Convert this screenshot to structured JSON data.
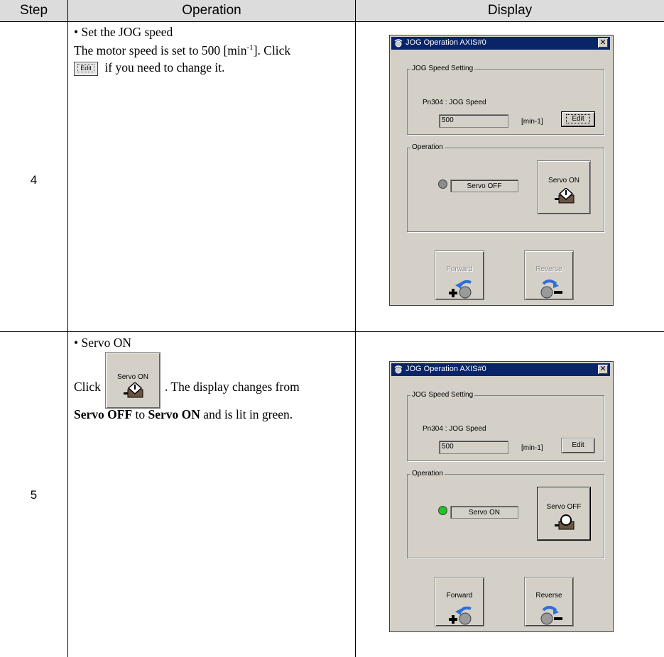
{
  "table": {
    "headers": {
      "step": "Step",
      "operation": "Operation",
      "display": "Display"
    }
  },
  "rows": [
    {
      "step": "4",
      "bullet": "•  Set the JOG speed",
      "text_1": "The motor speed is set to 500 [min",
      "superscript": "-1",
      "text_2": "]. Click",
      "inline_button": "Edit",
      "text_3": "if you need to change it."
    },
    {
      "step": "5",
      "bullet": "•  Servo ON",
      "click_word": "Click",
      "inline_button": "Servo ON",
      "text_after_button": ". The display changes from",
      "bold_1": "Servo OFF",
      "to_word": "to",
      "bold_2": "Servo ON",
      "text_end": "and is lit in green."
    }
  ],
  "dialogs": [
    {
      "title": "JOG Operation AXIS#0",
      "close_glyph": "✕",
      "speed_group": "JOG Speed Setting",
      "param_label": "Pn304 : JOG Speed",
      "speed_value": "500",
      "unit": "[min-1]",
      "edit_label": "Edit",
      "operation_group": "Operation",
      "servo_status": "Servo OFF",
      "servo_button": "Servo ON",
      "led_color": "#8c8c8c",
      "forward": "Forward",
      "reverse": "Reverse",
      "direction_enabled": false
    },
    {
      "title": "JOG Operation AXIS#0",
      "close_glyph": "✕",
      "speed_group": "JOG Speed Setting",
      "param_label": "Pn304 : JOG Speed",
      "speed_value": "500",
      "unit": "[min-1]",
      "edit_label": "Edit",
      "operation_group": "Operation",
      "servo_status": "Servo ON",
      "servo_button": "Servo OFF",
      "led_color": "#22c322",
      "forward": "Forward",
      "reverse": "Reverse",
      "direction_enabled": true
    }
  ],
  "icons": {
    "title_icon": "connection-icon",
    "servo_on_icon": "servo-motor-on-icon",
    "servo_off_icon": "servo-motor-off-icon",
    "forward_icon": "forward-rotation-icon",
    "reverse_icon": "reverse-rotation-icon"
  },
  "colors": {
    "title_bar": "#0a2469",
    "dialog_face": "#d4d0c8",
    "header_bg": "#dcdcdc",
    "arrow_blue": "#2f6fd8"
  }
}
